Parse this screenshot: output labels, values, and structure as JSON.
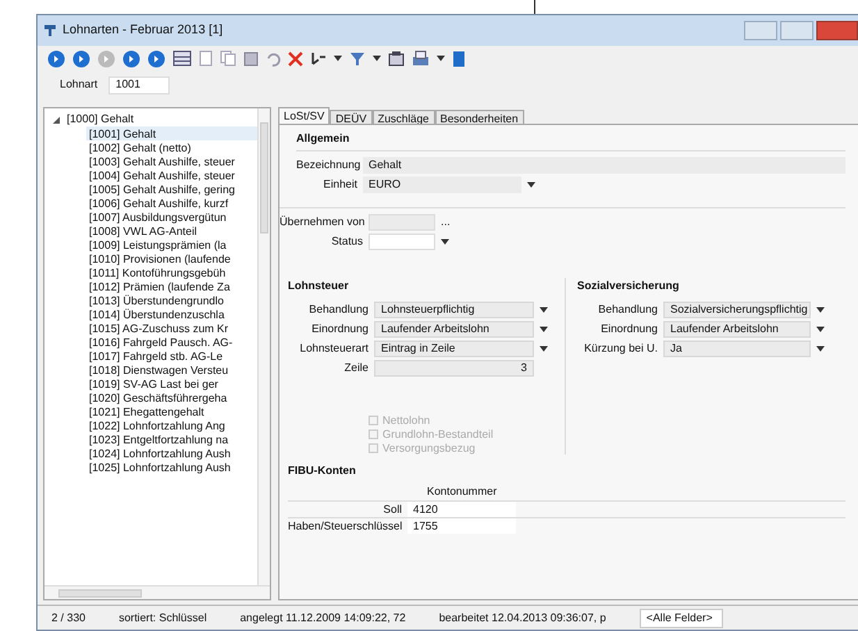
{
  "window": {
    "title": "Lohnarten - Februar 2013 [1]"
  },
  "filter": {
    "label": "Lohnart",
    "value": "1001"
  },
  "tree": [
    {
      "label": "[1000] Gehalt",
      "expanded": true,
      "selected": false,
      "children": [
        {
          "label": "[1001] Gehalt",
          "selected": true
        },
        {
          "label": "[1002] Gehalt (netto)",
          "selected": false
        },
        {
          "label": "[1003] Gehalt Aushilfe, steuer",
          "selected": false
        },
        {
          "label": "[1004] Gehalt Aushilfe, steuer",
          "selected": false
        },
        {
          "label": "[1005] Gehalt Aushilfe, gering",
          "selected": false
        },
        {
          "label": "[1006] Gehalt Aushilfe, kurzf",
          "selected": false
        },
        {
          "label": "[1007] Ausbildungsvergütun",
          "selected": false
        },
        {
          "label": "[1008] VWL AG-Anteil",
          "selected": false
        },
        {
          "label": "[1009] Leistungsprämien (la",
          "selected": false
        },
        {
          "label": "[1010] Provisionen (laufende",
          "selected": false
        },
        {
          "label": "[1011] Kontoführungsgebüh",
          "selected": false
        },
        {
          "label": "[1012] Prämien (laufende Za",
          "selected": false
        },
        {
          "label": "[1013] Überstundengrundlo",
          "selected": false
        },
        {
          "label": "[1014] Überstundenzuschla",
          "selected": false
        },
        {
          "label": "[1015] AG-Zuschuss zum Kr",
          "selected": false
        },
        {
          "label": "[1016] Fahrgeld Pausch. AG-",
          "selected": false
        },
        {
          "label": "[1017] Fahrgeld stb. AG-Le",
          "selected": false
        },
        {
          "label": "[1018] Dienstwagen Versteu",
          "selected": false
        },
        {
          "label": "[1019] SV-AG Last bei ger",
          "selected": false
        },
        {
          "label": "[1020] Geschäftsführergeha",
          "selected": false
        },
        {
          "label": "[1021] Ehegattengehalt",
          "selected": false
        },
        {
          "label": "[1022] Lohnfortzahlung Ang",
          "selected": false
        },
        {
          "label": "[1023] Entgeltfortzahlung na",
          "selected": false
        },
        {
          "label": "[1024] Lohnfortzahlung Aush",
          "selected": false
        },
        {
          "label": "[1025] Lohnfortzahlung Aush",
          "selected": false
        }
      ]
    }
  ],
  "tabs": [
    {
      "label": "LoSt/SV",
      "selected": true
    },
    {
      "label": "DEÜV",
      "selected": false
    },
    {
      "label": "Zuschläge",
      "selected": false
    },
    {
      "label": "Besonderheiten",
      "selected": false
    }
  ],
  "general": {
    "title": "Allgemein",
    "name_label": "Bezeichnung",
    "name": "Gehalt",
    "unit_label": "Einheit",
    "unit": "EURO",
    "copy_label": "Übernehmen von",
    "copy_button": "...",
    "status_label": "Status"
  },
  "wage_tax": {
    "title": "Lohnsteuer",
    "fields": [
      {
        "label": "Behandlung",
        "value": "Lohnsteuerpflichtig",
        "kind": "dropdown"
      },
      {
        "label": "Einordnung",
        "value": "Laufender Arbeitslohn",
        "kind": "dropdown"
      },
      {
        "label": "Lohnsteuerart",
        "value": "Eintrag in Zeile",
        "kind": "dropdown"
      },
      {
        "label": "Zeile",
        "value": "3",
        "kind": "number"
      }
    ],
    "options": [
      {
        "label": "Nettolohn",
        "checked": false,
        "disabled": true
      },
      {
        "label": "Grundlohn-Bestandteil",
        "checked": false,
        "disabled": true
      },
      {
        "label": "Versorgungsbezug",
        "checked": false,
        "disabled": true
      }
    ]
  },
  "social": {
    "title": "Sozialversicherung",
    "fields": [
      {
        "label": "Behandlung",
        "value": "Sozialversicherungspflichtig",
        "kind": "dropdown"
      },
      {
        "label": "Einordnung",
        "value": "Laufender Arbeitslohn",
        "kind": "dropdown"
      },
      {
        "label": "Kürzung bei U.",
        "value": "Ja",
        "kind": "dropdown"
      }
    ]
  },
  "accounts": {
    "title": "FIBU-Konten",
    "column": "Kontonummer",
    "rows": [
      {
        "label": "Soll",
        "value": "4120"
      },
      {
        "label": "Haben/Steuerschlüssel",
        "value": "1755"
      }
    ]
  },
  "status_bar": {
    "count": "2 / 330",
    "sort": "sortiert: Schlüssel",
    "created": "angelegt 11.12.2009 14:09:22, 72",
    "edited": "bearbeitet 12.04.2013 09:36:07, p",
    "fields": "<Alle Felder>"
  }
}
